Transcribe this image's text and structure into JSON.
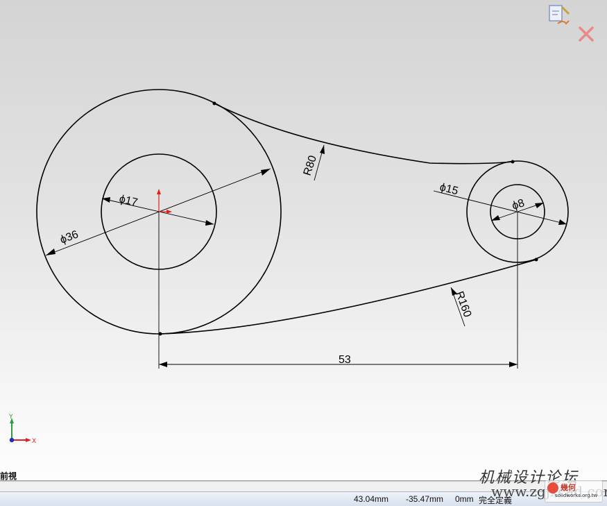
{
  "dimensions": {
    "dia_outer_left": "36",
    "dia_inner_left": "17",
    "dia_outer_right": "15",
    "dia_inner_right": "8",
    "radius_top": "R80",
    "radius_bottom": "R160",
    "center_distance": "53",
    "diameter_symbol": "ϕ"
  },
  "triad": {
    "y_label": "Y",
    "x_label": "X"
  },
  "view_name": "前視",
  "status": {
    "x": "43.04mm",
    "y": "-35.47mm",
    "z": "0mm",
    "state": "完全定義"
  },
  "watermark": {
    "cn": "机械设计论坛",
    "url": "www.zgjxcad.com",
    "tw_name": "幾何",
    "tw_url": "solidworks.org.tw"
  },
  "colors": {
    "sketch_line": "#000000",
    "origin_arrow": "#e0201b",
    "triad_y": "#2e9c3a",
    "triad_x": "#e02020",
    "triad_origin": "#1b2fbf"
  }
}
